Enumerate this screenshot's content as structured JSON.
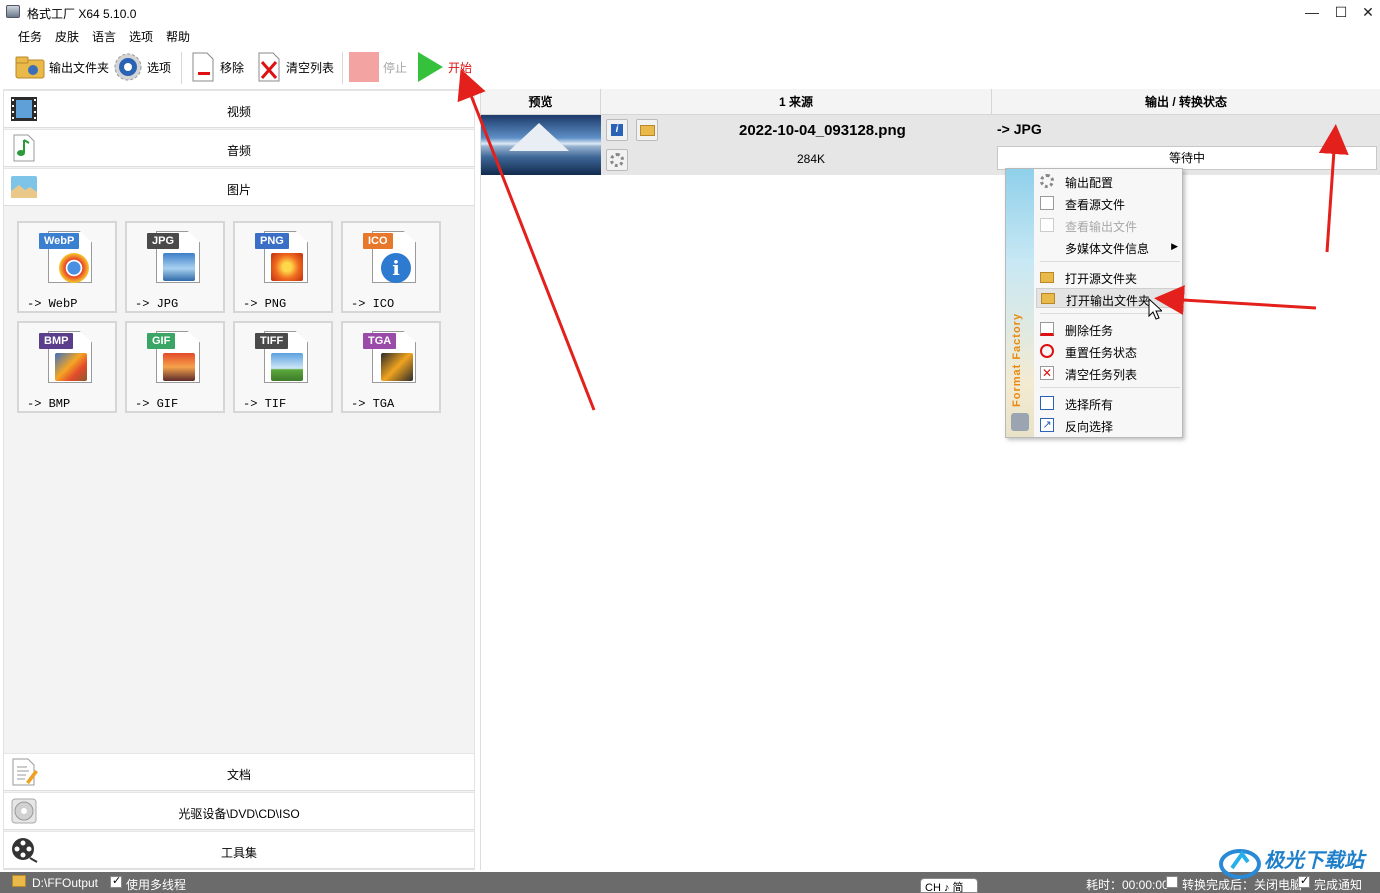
{
  "window": {
    "title": "格式工厂 X64 5.10.0",
    "minimize": "—",
    "maximize": "☐",
    "close": "✕"
  },
  "menu": [
    "任务",
    "皮肤",
    "语言",
    "选项",
    "帮助"
  ],
  "toolbar": {
    "output_folder": "输出文件夹",
    "options": "选项",
    "remove": "移除",
    "clear_list": "清空列表",
    "stop": "停止",
    "start": "开始"
  },
  "categories": {
    "video": "视频",
    "audio": "音频",
    "image": "图片",
    "document": "文档",
    "optical": "光驱设备\\DVD\\CD\\ISO",
    "tools": "工具集"
  },
  "image_formats": [
    {
      "badge": "WebP",
      "label": "-> WebP",
      "color": "#3b7fd1"
    },
    {
      "badge": "JPG",
      "label": "-> JPG",
      "color": "#4a4a4a"
    },
    {
      "badge": "PNG",
      "label": "-> PNG",
      "color": "#3b6fc6"
    },
    {
      "badge": "ICO",
      "label": "-> ICO",
      "color": "#e7772a"
    },
    {
      "badge": "BMP",
      "label": "-> BMP",
      "color": "#5a3e8c"
    },
    {
      "badge": "GIF",
      "label": "-> GIF",
      "color": "#3aa564"
    },
    {
      "badge": "TIFF",
      "label": "-> TIF",
      "color": "#4a4a4a"
    },
    {
      "badge": "TGA",
      "label": "-> TGA",
      "color": "#9a4ba8"
    }
  ],
  "table": {
    "headers": [
      "预览",
      "1 来源",
      "输出 / 转换状态"
    ],
    "row": {
      "filename": "2022-10-04_093128.png",
      "size": "284K",
      "output_format": "-> JPG",
      "status": "等待中"
    }
  },
  "context_menu": {
    "brand": "Format Factory",
    "items": [
      {
        "label": "输出配置",
        "enabled": true
      },
      {
        "label": "查看源文件",
        "enabled": true
      },
      {
        "label": "查看输出文件",
        "enabled": false
      },
      {
        "label": "多媒体文件信息",
        "enabled": true
      },
      {
        "label": "打开源文件夹",
        "enabled": true
      },
      {
        "label": "打开输出文件夹",
        "enabled": true
      },
      {
        "label": "删除任务",
        "enabled": true
      },
      {
        "label": "重置任务状态",
        "enabled": true
      },
      {
        "label": "清空任务列表",
        "enabled": true
      },
      {
        "label": "选择所有",
        "enabled": true
      },
      {
        "label": "反向选择",
        "enabled": true
      }
    ]
  },
  "statusbar": {
    "output_path": "D:\\FFOutput",
    "multithread": "使用多线程",
    "elapsed": "耗时：00:00:00",
    "after_convert": "转换完成后：关闭电脑",
    "notify": "完成通知",
    "ime": "CH ♪ 简"
  },
  "watermark": "极光下载站"
}
